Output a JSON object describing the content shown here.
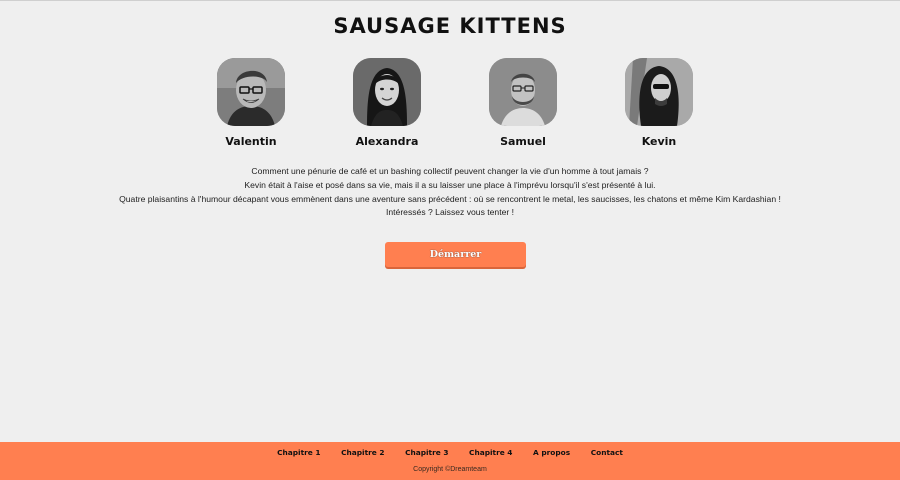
{
  "site": {
    "title": "SAUSAGE KITTENS"
  },
  "team": [
    {
      "name": "Valentin",
      "photo": "valentin-portrait"
    },
    {
      "name": "Alexandra",
      "photo": "alexandra-portrait"
    },
    {
      "name": "Samuel",
      "photo": "samuel-portrait"
    },
    {
      "name": "Kevin",
      "photo": "kevin-portrait"
    }
  ],
  "intro": {
    "lines": [
      "Comment une pénurie de café et un bashing collectif peuvent changer la vie d'un homme à tout jamais ?",
      "Kevin était à l'aise et posé dans sa vie, mais il a su laisser une place à l'imprévu lorsqu'il s'est présenté à lui.",
      "Quatre plaisantins à l'humour décapant vous emmènent dans une aventure sans précédent : où se rencontrent le metal, les saucisses, les chatons et même Kim Kardashian !",
      "Intéressés ? Laissez vous tenter !"
    ]
  },
  "cta": {
    "label": "Démarrer"
  },
  "footer": {
    "nav": [
      "Chapitre 1",
      "Chapitre 2",
      "Chapitre 3",
      "Chapitre 4",
      "A propos",
      "Contact"
    ],
    "copyright": "Copyright ©Dreamteam"
  },
  "colors": {
    "accent": "#ff7f50",
    "background": "#efefef"
  }
}
